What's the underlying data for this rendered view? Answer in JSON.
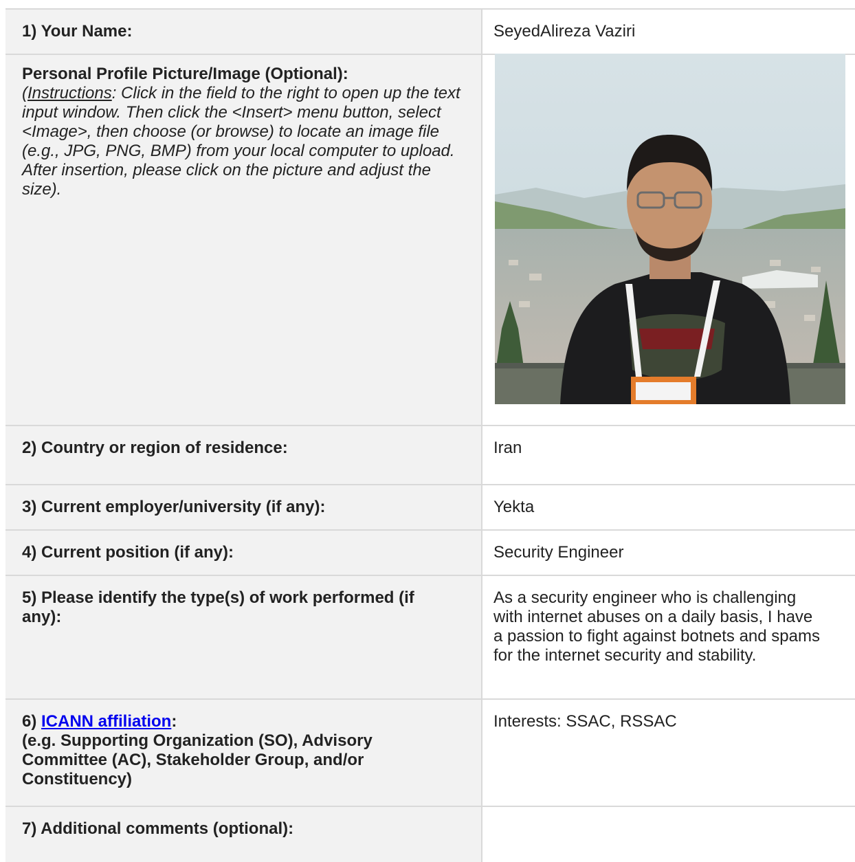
{
  "rows": [
    {
      "label": "1) Your Name:",
      "value": "SeyedAlireza Vaziri"
    },
    {
      "label": "Personal Profile Picture/Image (Optional):",
      "instructions_open": "(",
      "instructions_word": "Instructions",
      "instructions_text": ": Click in the field to the right to open up the text input window. Then click the <Insert> menu button, select <Image>, then choose (or browse) to locate an image file (e.g., JPG, PNG, BMP) from your local computer to upload. After insertion, please click on the picture and adjust the size)."
    },
    {
      "label": "2) Country or region of residence:",
      "value": "Iran"
    },
    {
      "label": "3) Current employer/university (if any):",
      "value": "Yekta"
    },
    {
      "label": "4) Current position (if any):",
      "value": "Security Engineer"
    },
    {
      "label": "5) Please identify the type(s) of work performed (if any):",
      "value": "As a security engineer who is challenging with internet abuses on a daily basis, I have a passion to fight against botnets and spams for the internet security and stability."
    },
    {
      "label_prefix": "6) ",
      "link_text": "ICANN affiliation",
      "label_suffix": ":",
      "label_note": "(e.g. Supporting Organization (SO), Advisory Committee (AC), Stakeholder Group, and/or Constituency)",
      "value": "Interests: SSAC, RSSAC"
    },
    {
      "label": "7) Additional comments (optional):",
      "value": ""
    }
  ],
  "colors": {
    "label_bg": "#f2f2f2",
    "border": "#d9d9d9",
    "link": "#0000ee"
  }
}
